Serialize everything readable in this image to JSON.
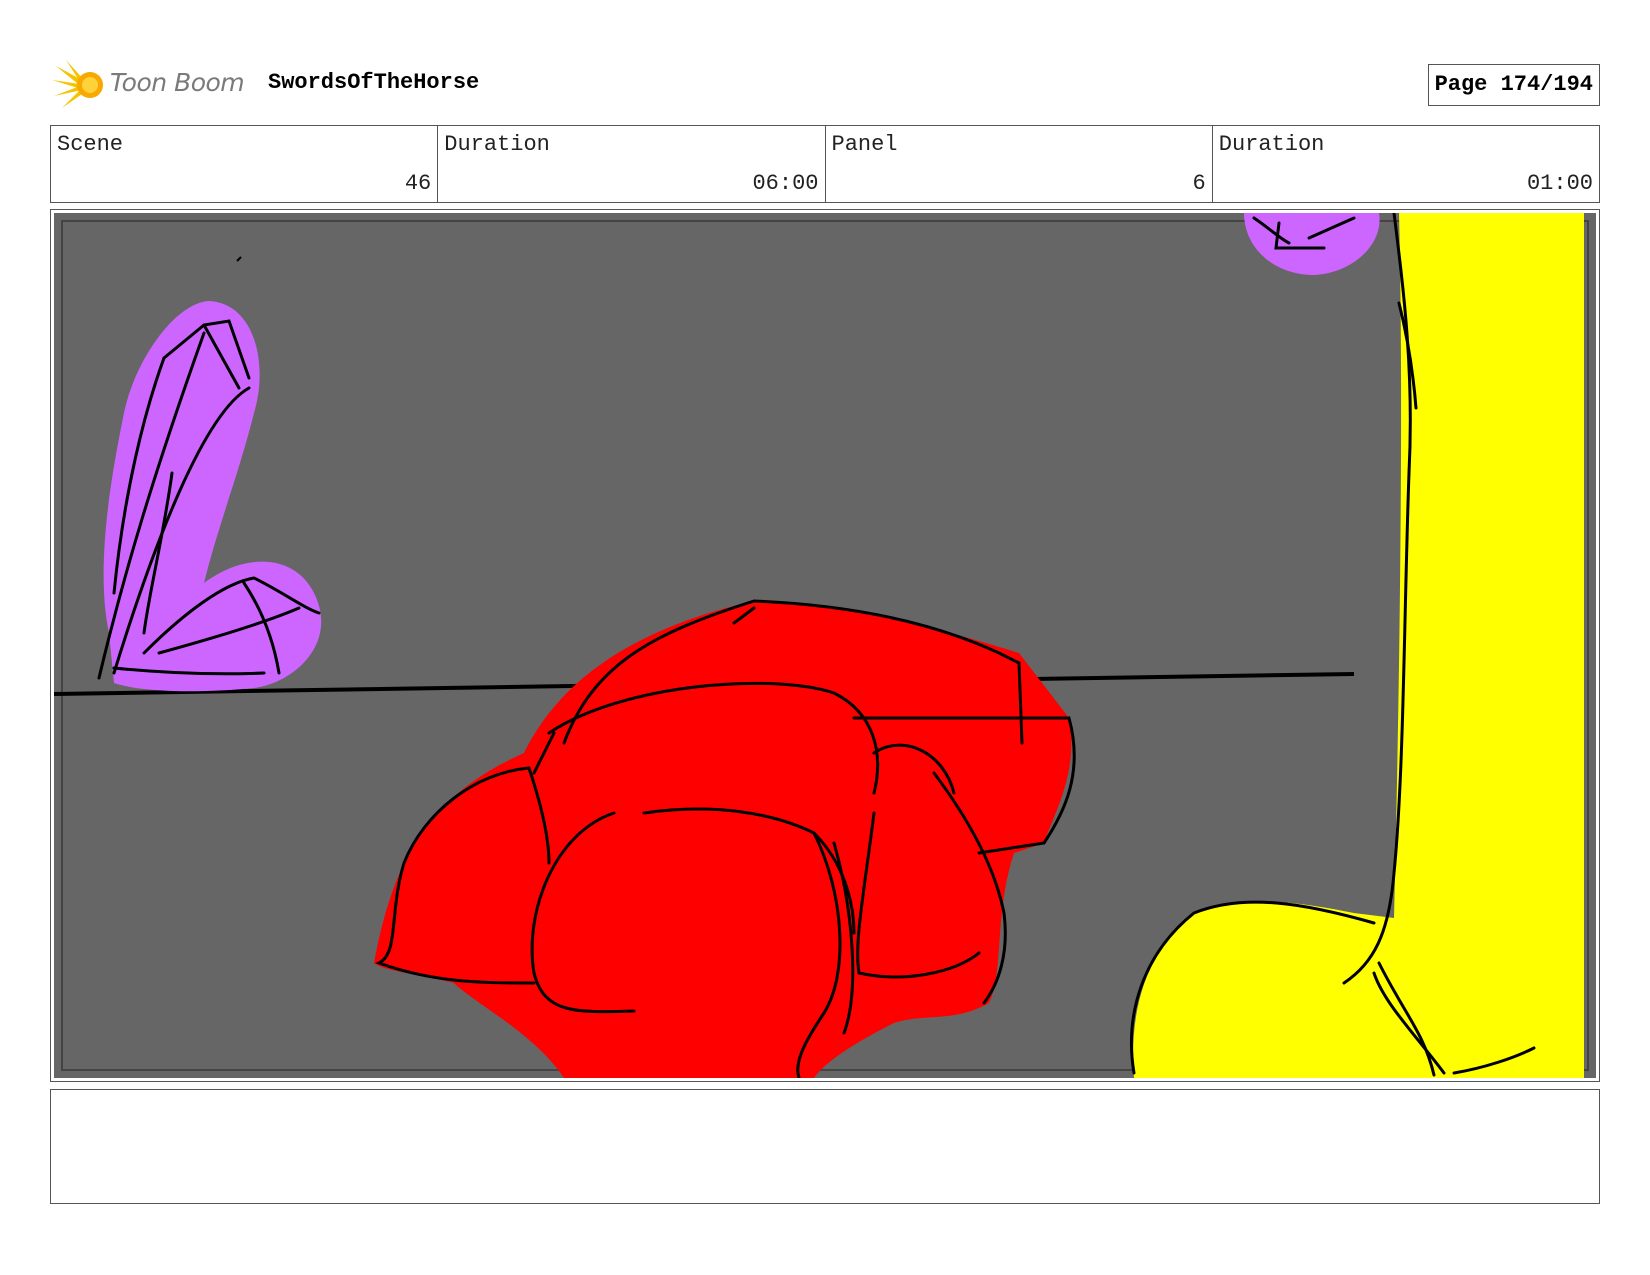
{
  "header": {
    "logo_text": "Toon Boom",
    "project_title": "SwordsOfTheHorse",
    "page_label": "Page 174/194"
  },
  "info": [
    {
      "label": "Scene",
      "value": "46"
    },
    {
      "label": "Duration",
      "value": "06:00"
    },
    {
      "label": "Panel",
      "value": "6"
    },
    {
      "label": "Duration",
      "value": "01:00"
    }
  ],
  "panel": {
    "background_color": "#666666",
    "colors": {
      "purple": "#cc66ff",
      "red": "#ff0000",
      "yellow": "#ffff00",
      "ink": "#000000"
    }
  },
  "notes": {
    "text": ""
  }
}
